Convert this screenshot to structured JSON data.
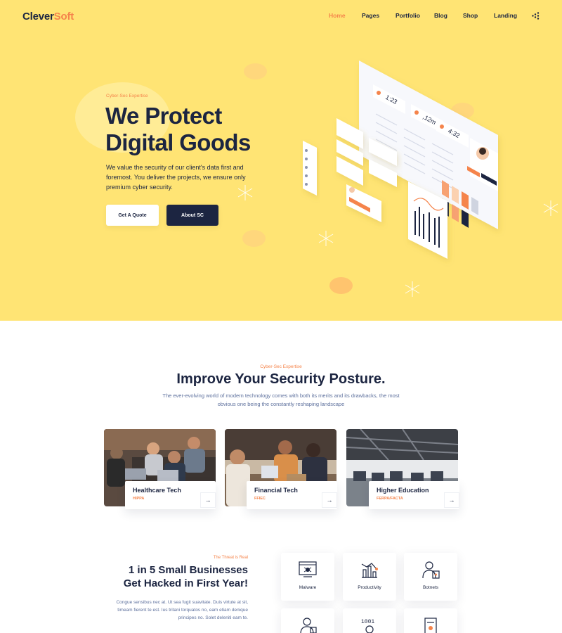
{
  "brand": {
    "part1": "Clever",
    "part2": "Soft"
  },
  "nav": [
    {
      "label": "Home",
      "active": true
    },
    {
      "label": "Pages",
      "active": false
    },
    {
      "label": "Portfolio",
      "active": false
    },
    {
      "label": "Blog",
      "active": false
    },
    {
      "label": "Shop",
      "active": false
    },
    {
      "label": "Landing",
      "active": false
    }
  ],
  "hero": {
    "eyebrow": "Cyber-Sec Expertise",
    "title_line1": "We Protect",
    "title_line2": "Digital Goods",
    "description": "We value the security of our client's data first and foremost. You deliver the projects, we ensure only premium cyber security.",
    "btn_primary": "Get A Quote",
    "btn_secondary": "About SC",
    "dashboard_stats": [
      "1:23",
      ",12m",
      "4:32"
    ]
  },
  "posture": {
    "eyebrow": "Cyber-Sec Expertise",
    "title": "Improve Your Security Posture.",
    "description": "The ever-evolving world of modern technology comes with both its merits and its drawbacks, the most obvious one being the constantly reshaping landscape",
    "cards": [
      {
        "title": "Healthcare Tech",
        "tag": "HIPPA",
        "arrow": "→"
      },
      {
        "title": "Financial Tech",
        "tag": "FFIEC",
        "arrow": "→"
      },
      {
        "title": "Higher Education",
        "tag": "FERPA/FACTA",
        "arrow": "→"
      }
    ]
  },
  "threat": {
    "eyebrow": "The Threat is Real",
    "title_line1": "1 in 5 Small Businesses",
    "title_line2": "Get Hacked in First Year!",
    "description": "Congue sensibus nec at. Ut sea fugit suavitate. Duis virtute at sit, timeam fierent te est. Ius tritani torquatos no, eam etiam denique principes no. Solet deleniti eam te.",
    "features": [
      {
        "label": "Malware",
        "icon": "malware-icon"
      },
      {
        "label": "Productivity",
        "icon": "productivity-icon"
      },
      {
        "label": "Botnets",
        "icon": "botnets-icon"
      },
      {
        "label": "",
        "icon": "hacker-icon"
      },
      {
        "label": "",
        "icon": "binary-code-icon"
      },
      {
        "label": "",
        "icon": "secure-document-icon"
      }
    ]
  },
  "colors": {
    "accent": "#f5844b",
    "navy": "#1c2541",
    "hero_bg": "#ffe474",
    "muted": "#5c6f9c"
  }
}
